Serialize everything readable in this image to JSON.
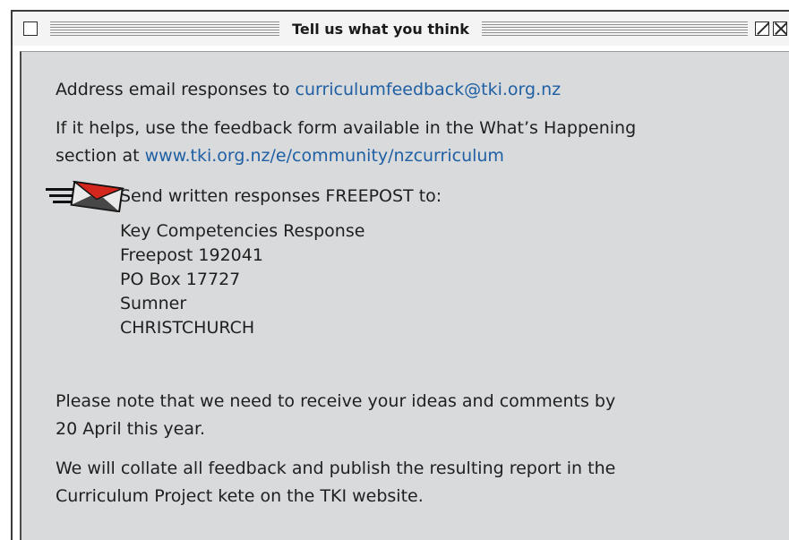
{
  "window": {
    "title": "Tell us what you think"
  },
  "content": {
    "email_prefix": "Address email responses to ",
    "email_link": "curriculumfeedback@tki.org.nz",
    "form_line1": "If it helps, use the feedback form available in the What’s Happening",
    "form_line2_prefix": "section at ",
    "form_link": "www.tki.org.nz/e/community/nzcurriculum",
    "freepost_label": "Send written responses FREEPOST to:",
    "address_lines": [
      "Key Competencies Response",
      "Freepost 192041",
      "PO Box 17727",
      "Sumner",
      "CHRISTCHURCH"
    ],
    "deadline_line1": "Please note that we need to receive your ideas and comments by",
    "deadline_line2": "20 April this year.",
    "collate_line1": "We will collate all feedback and publish the resulting report in the",
    "collate_line2": "Curriculum Project kete on the TKI website."
  },
  "icons": {
    "close": "close-box-icon",
    "zoom": "zoom-box-icon",
    "collapse": "collapse-box-icon",
    "mail": "envelope-icon"
  },
  "colors": {
    "link": "#1f5fa3",
    "panel_background": "#d8dadc",
    "envelope_red": "#d3261d"
  }
}
